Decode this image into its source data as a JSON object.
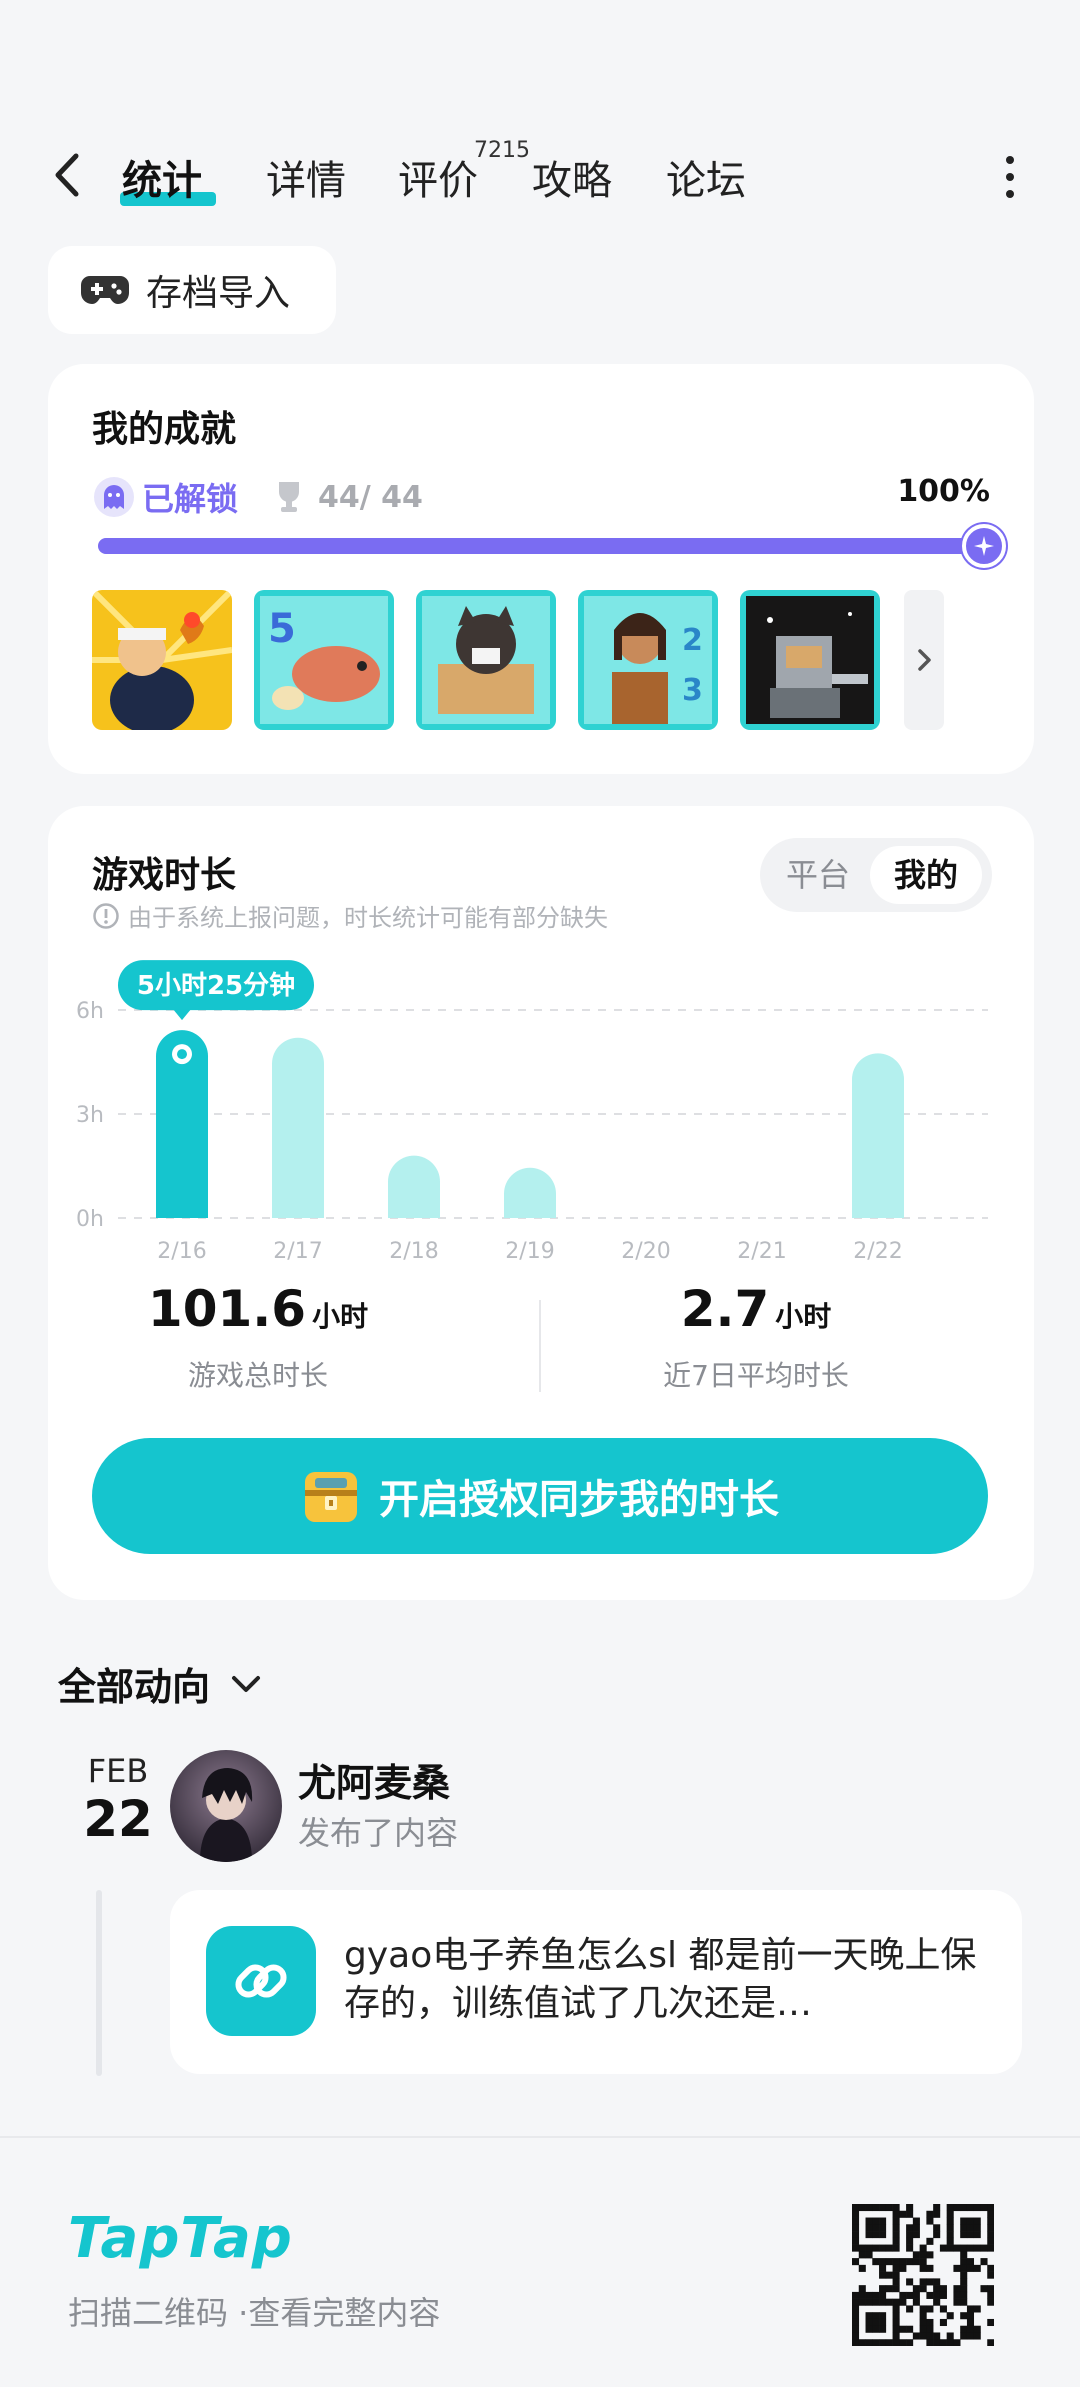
{
  "nav": {
    "tabs": [
      {
        "label": "统计",
        "active": true
      },
      {
        "label": "详情",
        "active": false
      },
      {
        "label": "评价",
        "active": false
      },
      {
        "label": "攻略",
        "active": false
      },
      {
        "label": "论坛",
        "active": false
      }
    ],
    "review_count": "7215"
  },
  "import_button": {
    "label": "存档导入",
    "icon": "gamepad-icon"
  },
  "achievements": {
    "title": "我的成就",
    "unlock_label": "已解锁",
    "count": "44/ 44",
    "percent_text": "100%",
    "progress": 1.0,
    "accent": "#7a6cf2"
  },
  "playtime": {
    "title": "游戏时长",
    "note": "由于系统上报问题，时长统计可能有部分缺失",
    "toggle": {
      "platform": "平台",
      "mine": "我的"
    },
    "tooltip": "5小时25分钟",
    "total": {
      "value": "101.6",
      "unit": "小时",
      "label": "游戏总时长"
    },
    "average": {
      "value": "2.7",
      "unit": "小时",
      "label": "近7日平均时长"
    },
    "sync_button": "开启授权同步我的时长"
  },
  "chart_data": {
    "type": "bar",
    "categories": [
      "2/16",
      "2/17",
      "2/18",
      "2/19",
      "2/20",
      "2/21",
      "2/22"
    ],
    "values": [
      5.42,
      5.2,
      1.8,
      1.45,
      0,
      0,
      4.75
    ],
    "y_ticks": [
      "0h",
      "3h",
      "6h"
    ],
    "ylim": [
      0,
      6
    ],
    "highlight_index": 0,
    "colors": {
      "highlight": "#15c5ce",
      "normal": "#b4f0ee",
      "grid": "#dedfe2"
    }
  },
  "feed": {
    "header": "全部动向",
    "items": [
      {
        "month": "FEB",
        "day": "22",
        "user": "尤阿麦桑",
        "action": "发布了内容",
        "text": "gyao电子养鱼怎么sl 都是前一天晚上保存的，训练值试了几次还是…"
      }
    ]
  },
  "footer": {
    "logo": "TapTap",
    "subtitle": "扫描二维码 ·查看完整内容"
  },
  "colors": {
    "brand": "#15c5ce",
    "achievement": "#7a6cf2",
    "background": "#f5f6f8"
  }
}
